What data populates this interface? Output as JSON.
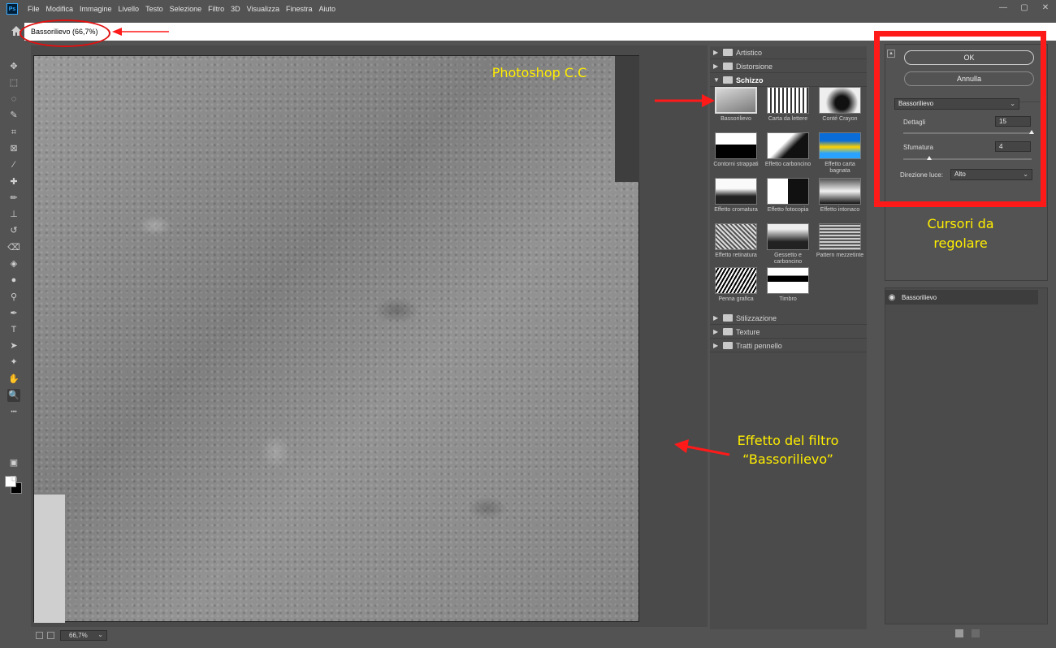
{
  "menubar": {
    "logo": "Ps",
    "items": [
      "File",
      "Modifica",
      "Immagine",
      "Livello",
      "Testo",
      "Selezione",
      "Filtro",
      "3D",
      "Visualizza",
      "Finestra",
      "Aiuto"
    ],
    "window_controls": [
      "—",
      "▢",
      "✕"
    ]
  },
  "document": {
    "title": "Bassorilievo (66,7%)"
  },
  "toolbar": {
    "tools": [
      {
        "name": "move-tool",
        "glyph": "✥"
      },
      {
        "name": "marquee-tool",
        "glyph": "⬚"
      },
      {
        "name": "lasso-tool",
        "glyph": "◌"
      },
      {
        "name": "quick-select-tool",
        "glyph": "✎"
      },
      {
        "name": "crop-tool",
        "glyph": "⌗"
      },
      {
        "name": "frame-tool",
        "glyph": "⊠"
      },
      {
        "name": "eyedropper-tool",
        "glyph": "⁄"
      },
      {
        "name": "healing-brush-tool",
        "glyph": "✚"
      },
      {
        "name": "brush-tool",
        "glyph": "✏"
      },
      {
        "name": "clone-stamp-tool",
        "glyph": "⊥"
      },
      {
        "name": "history-brush-tool",
        "glyph": "↺"
      },
      {
        "name": "eraser-tool",
        "glyph": "⌫"
      },
      {
        "name": "paint-bucket-tool",
        "glyph": "◈"
      },
      {
        "name": "blur-tool",
        "glyph": "●"
      },
      {
        "name": "dodge-tool",
        "glyph": "⚲"
      },
      {
        "name": "pen-tool",
        "glyph": "✒"
      },
      {
        "name": "type-tool",
        "glyph": "T"
      },
      {
        "name": "path-select-tool",
        "glyph": "➤"
      },
      {
        "name": "custom-shape-tool",
        "glyph": "✦"
      },
      {
        "name": "hand-tool",
        "glyph": "✋"
      },
      {
        "name": "zoom-tool",
        "glyph": "🔍"
      },
      {
        "name": "more-tools",
        "glyph": "•••"
      }
    ],
    "active_tool": "zoom-tool"
  },
  "preview": {
    "zoom": "66,7%"
  },
  "categories": [
    {
      "label": "Artistico",
      "open": false
    },
    {
      "label": "Distorsione",
      "open": false
    },
    {
      "label": "Schizzo",
      "open": true
    },
    {
      "label": "Stilizzazione",
      "open": false
    },
    {
      "label": "Texture",
      "open": false
    },
    {
      "label": "Tratti pennello",
      "open": false
    }
  ],
  "thumbnails": [
    {
      "label": "Bassorilievo",
      "selected": true
    },
    {
      "label": "Carta da lettere",
      "selected": false
    },
    {
      "label": "Conté Crayon",
      "selected": false
    },
    {
      "label": "Contorni strappati",
      "selected": false
    },
    {
      "label": "Effetto carboncino",
      "selected": false
    },
    {
      "label": "Effetto carta bagnata",
      "selected": false
    },
    {
      "label": "Effetto cromatura",
      "selected": false
    },
    {
      "label": "Effetto fotocopia",
      "selected": false
    },
    {
      "label": "Effetto intonaco",
      "selected": false
    },
    {
      "label": "Effetto retinatura",
      "selected": false
    },
    {
      "label": "Gessetto e carboncino",
      "selected": false
    },
    {
      "label": "Pattern mezzetinte",
      "selected": false
    },
    {
      "label": "Penna grafica",
      "selected": false
    },
    {
      "label": "Timbro",
      "selected": false
    }
  ],
  "settings": {
    "ok_label": "OK",
    "cancel_label": "Annulla",
    "filter_select": "Bassorilievo",
    "dettagli_label": "Dettagli",
    "dettagli_value": "15",
    "dettagli_fraction": 1.0,
    "sfumatura_label": "Sfumatura",
    "sfumatura_value": "4",
    "sfumatura_fraction": 0.2,
    "direzione_label": "Direzione luce:",
    "direzione_value": "Alto"
  },
  "layers": {
    "items": [
      "Bassorilievo"
    ]
  },
  "annotations": {
    "photoshop_label": "Photoshop C.C",
    "cursori_label_1": "Cursori da",
    "cursori_label_2": "regolare",
    "effetto_label_1": "Effetto del filtro",
    "effetto_label_2": "“Bassorilievo”",
    "colors": {
      "box": "#ff1a1a",
      "text": "#ffee00"
    }
  }
}
